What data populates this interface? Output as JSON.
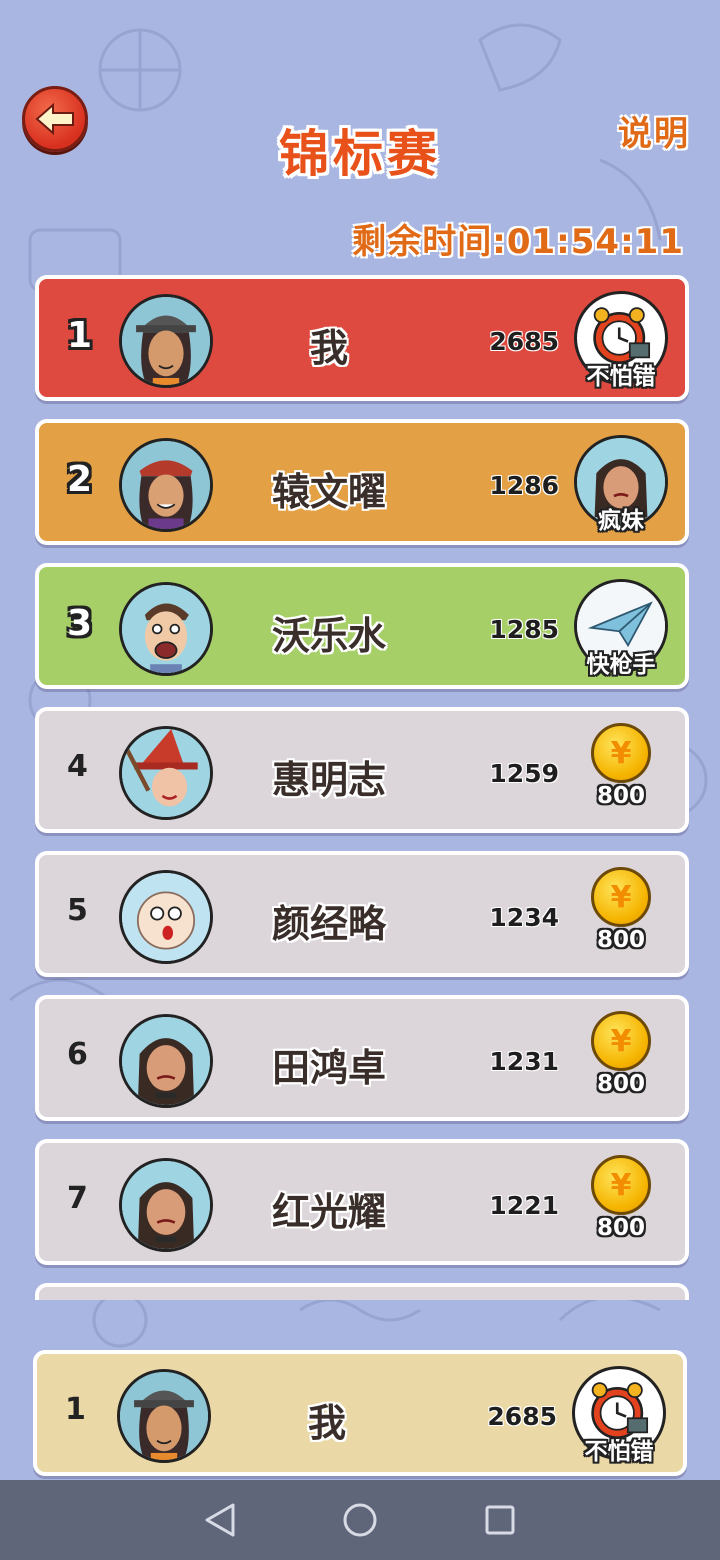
{
  "header": {
    "title": "锦标赛",
    "help_label": "说明",
    "timer_text": "剩余时间:01:54:11"
  },
  "colors": {
    "background": "#a9b6e2",
    "rank1": "#de4a3f",
    "rank2": "#e3a044",
    "rank3": "#a6cf68",
    "default_row": "#dcd5d9",
    "my_row": "#ead9a6",
    "title_orange": "#e8521a"
  },
  "rows": [
    {
      "rank": "1",
      "name": "我",
      "score": "2685",
      "reward_type": "badge",
      "reward_icon": "alarm-clock-icon",
      "reward_label": "不怕错"
    },
    {
      "rank": "2",
      "name": "辕文曜",
      "score": "1286",
      "reward_type": "badge",
      "reward_icon": "girl-face-icon",
      "reward_label": "疯妹"
    },
    {
      "rank": "3",
      "name": "沃乐水",
      "score": "1285",
      "reward_type": "badge",
      "reward_icon": "paper-plane-icon",
      "reward_label": "快枪手"
    },
    {
      "rank": "4",
      "name": "惠明志",
      "score": "1259",
      "reward_type": "coin",
      "reward_icon": "gold-coin-icon",
      "reward_label": "800"
    },
    {
      "rank": "5",
      "name": "颜经略",
      "score": "1234",
      "reward_type": "coin",
      "reward_icon": "gold-coin-icon",
      "reward_label": "800"
    },
    {
      "rank": "6",
      "name": "田鸿卓",
      "score": "1231",
      "reward_type": "coin",
      "reward_icon": "gold-coin-icon",
      "reward_label": "800"
    },
    {
      "rank": "7",
      "name": "红光耀",
      "score": "1221",
      "reward_type": "coin",
      "reward_icon": "gold-coin-icon",
      "reward_label": "800"
    }
  ],
  "my_entry": {
    "rank": "1",
    "name": "我",
    "score": "2685",
    "reward_icon": "alarm-clock-icon",
    "reward_label": "不怕错"
  },
  "coin_symbol": "¥"
}
